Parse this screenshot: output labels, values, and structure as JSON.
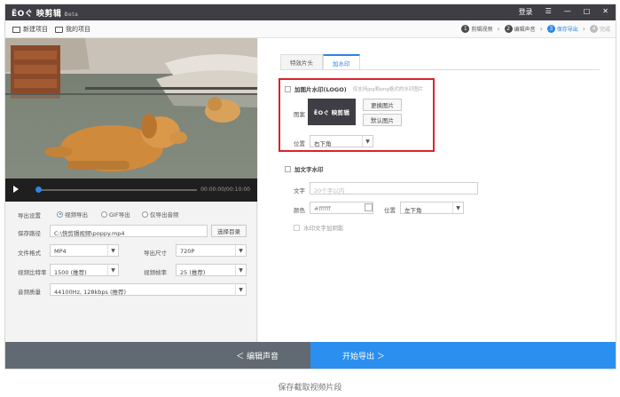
{
  "app": {
    "logo": "ЁOぐ 映剪辑",
    "beta": "Beta",
    "window_controls": {
      "login": "登录",
      "menu": "☰",
      "minimize": "—",
      "maximize": "□",
      "close": "✕"
    }
  },
  "toolbar": {
    "new_project": "新建项目",
    "my_projects": "我的项目",
    "steps": [
      {
        "num": "1",
        "label": "剪辑视频"
      },
      {
        "num": "2",
        "label": "编辑声音"
      },
      {
        "num": "3",
        "label": "保存导出"
      },
      {
        "num": "4",
        "label": "完成"
      }
    ]
  },
  "player": {
    "time": "00:00:00/00:10:00"
  },
  "export": {
    "settings_label": "导出设置",
    "modes": [
      "视频导出",
      "GIF导出",
      "仅导出音频"
    ],
    "path_label": "保存路径",
    "path_value": "C:\\快剪辑视频\\poppy.mp4",
    "browse_button": "选择目录",
    "format_label": "文件格式",
    "format_value": "MP4",
    "size_label": "导出尺寸",
    "size_value": "720P",
    "bitrate_label": "视频比特率",
    "bitrate_value": "1500 (推荐)",
    "framerate_label": "视频帧率",
    "framerate_value": "25 (推荐)",
    "audio_label": "音频质量",
    "audio_value": "44100Hz, 128kbps (推荐)"
  },
  "tabs": [
    "特效片头",
    "加水印"
  ],
  "watermark": {
    "image_title": "加图片水印(LOGO)",
    "image_hint": "仅支持jpg和png格式的水印图片",
    "pattern_label": "图案",
    "logo_preview": "ЁOぐ 映剪辑",
    "change_button": "更换图片",
    "default_button": "默认图片",
    "position_label": "位置",
    "position_value": "右下角",
    "text_title": "加文字水印",
    "text_label": "文字",
    "text_placeholder": "20个字以内",
    "color_label": "颜色",
    "color_value": "#ffffff",
    "text_position_label": "位置",
    "text_position_value": "左下角",
    "shadow_label": "水印文字加阴影"
  },
  "bottom": {
    "back": "＜  编辑声音",
    "start": "开始导出  ＞"
  },
  "caption": "保存截取视频片段",
  "colors": {
    "accent": "#2b86e6",
    "highlight": "#d9232b",
    "titlebar": "#3e3e44"
  }
}
